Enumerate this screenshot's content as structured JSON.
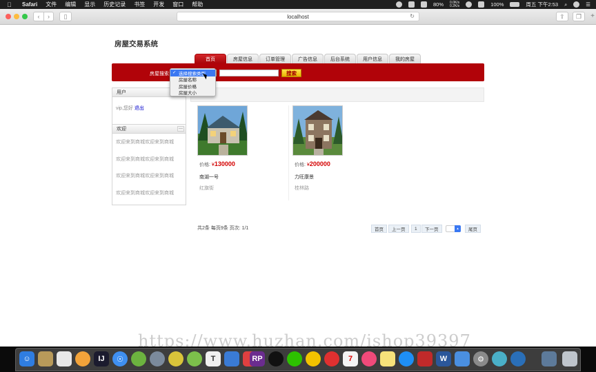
{
  "menubar": {
    "app_name": "Safari",
    "items": [
      "文件",
      "编辑",
      "显示",
      "历史记录",
      "书签",
      "开发",
      "窗口",
      "帮助"
    ],
    "net_speed_up": "0.0K/s",
    "net_speed_down": "0.2K/s",
    "battery_small": "80%",
    "battery": "100%",
    "datetime": "周五 下午2:53"
  },
  "browser": {
    "url": "localhost"
  },
  "site": {
    "title": "房屋交易系统",
    "nav_tabs": [
      "首页",
      "房屋信息",
      "订单管理",
      "广告信息",
      "后台系统",
      "用户信息",
      "我的房屋"
    ],
    "active_tab": "首页",
    "search": {
      "label": "房屋搜索",
      "button": "搜索",
      "options": [
        "选择搜索类型",
        "房屋名称",
        "房屋价格",
        "房屋大小"
      ],
      "selected": "选择搜索类型"
    }
  },
  "sidebar": {
    "user_panel_title": "用户",
    "user_greeting": "vip,您好",
    "logout": "退出",
    "welcome_panel_title": "欢迎",
    "collapse": "—",
    "welcome_items": [
      "欢迎来到商城欢迎来到商城",
      "欢迎来到商城欢迎来到商城",
      "欢迎来到商城欢迎来到商城",
      "欢迎来到商城欢迎来到商城"
    ]
  },
  "listings": [
    {
      "price_label": "价格:",
      "currency": "¥",
      "price": "130000",
      "name": "南湖一号",
      "address": "红旗街"
    },
    {
      "price_label": "价格:",
      "currency": "¥",
      "price": "200000",
      "name": "力旺康景",
      "address": "桂林路"
    }
  ],
  "pagination": {
    "info": "共2条 每页9条 页次: 1/1",
    "first": "首页",
    "prev": "上一页",
    "current": "1",
    "next": "下一页",
    "last": "尾页"
  },
  "watermark": "https://www.huzhan.com/ishop39397",
  "colors": {
    "brand_red": "#b10309",
    "price_red": "#d40000",
    "search_button": "#eab400"
  }
}
